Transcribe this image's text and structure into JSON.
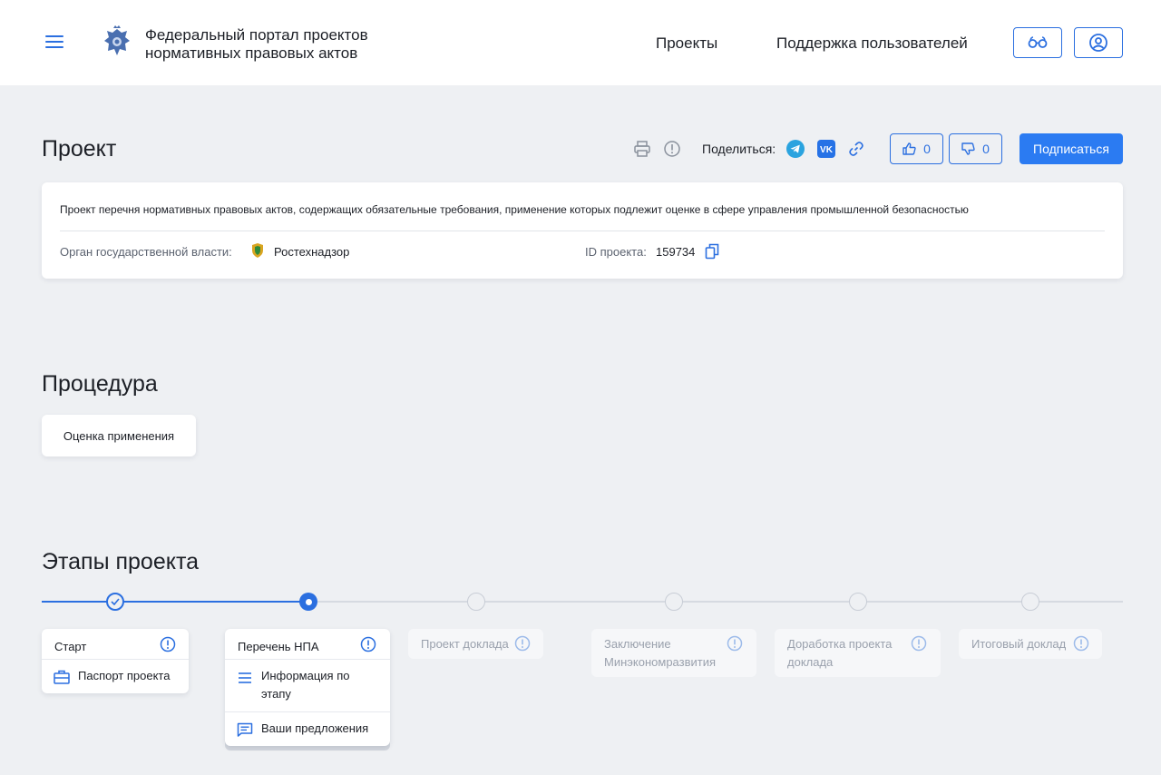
{
  "header": {
    "site_title_line1": "Федеральный портал проектов",
    "site_title_line2": "нормативных правовых актов",
    "nav": {
      "projects": "Проекты",
      "support": "Поддержка пользователей"
    },
    "icons": {
      "menu": "menu-icon",
      "emblem": "emblem-icon",
      "glasses": "glasses-icon",
      "user": "user-icon"
    }
  },
  "project": {
    "title": "Проект",
    "share_label": "Поделиться:",
    "likes": "0",
    "dislikes": "0",
    "subscribe_label": "Подписаться",
    "description": "Проект перечня нормативных правовых актов, содержащих обязательные требования, применение которых подлежит оценке в сфере управления промышленной безопасностью",
    "org_label": "Орган государственной власти:",
    "org_value": "Ростехнадзор",
    "id_label": "ID проекта:",
    "id_value": "159734"
  },
  "procedure": {
    "title": "Процедура",
    "value": "Оценка применения"
  },
  "stages": {
    "title": "Этапы проекта",
    "items": [
      {
        "label": "Старт",
        "status": "done",
        "rows": [
          {
            "icon": "briefcase-icon",
            "label": "Паспорт проекта"
          }
        ]
      },
      {
        "label": "Перечень НПА",
        "status": "current",
        "rows": [
          {
            "icon": "list-icon",
            "label": "Информация по этапу"
          },
          {
            "icon": "comment-icon",
            "label": "Ваши предложения"
          }
        ]
      },
      {
        "label": "Проект доклада",
        "status": "future"
      },
      {
        "label": "Заключение Минэкономразвития",
        "status": "future"
      },
      {
        "label": "Доработка проекта доклада",
        "status": "future"
      },
      {
        "label": "Итоговый доклад",
        "status": "future"
      }
    ]
  },
  "colors": {
    "accent": "#2b6fe0",
    "button": "#2b7bf2",
    "background": "#eef0f3",
    "muted_text": "#9aa1ad"
  }
}
